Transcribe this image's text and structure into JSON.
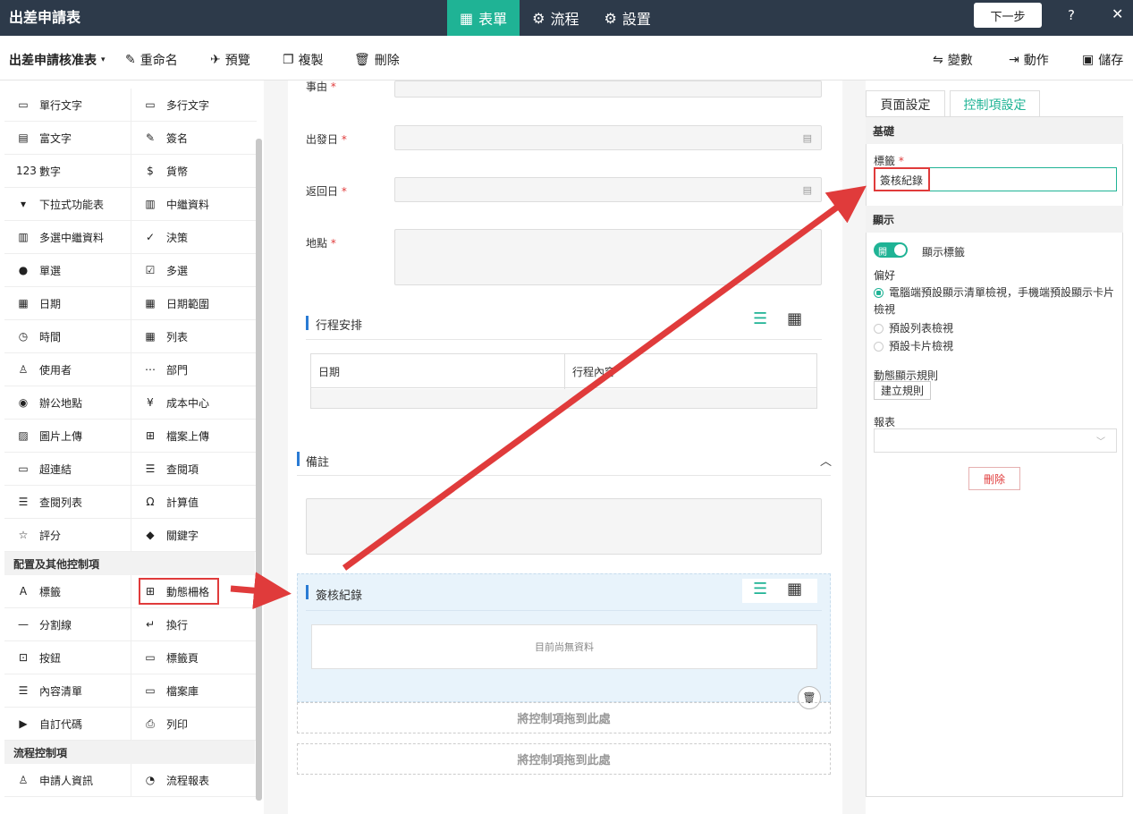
{
  "topbar": {
    "title": "出差申請表",
    "tabs": [
      {
        "label": "表單",
        "icon": "grid-icon"
      },
      {
        "label": "流程",
        "icon": "cogs-icon"
      },
      {
        "label": "設置",
        "icon": "gear-icon"
      }
    ],
    "next_label": "下一步",
    "help_label": "?",
    "close_label": "✕"
  },
  "toolbar": {
    "form_name": "出差申請核准表",
    "rename": "重命名",
    "preview": "預覽",
    "copy": "複製",
    "delete": "刪除",
    "variables": "變數",
    "actions": "動作",
    "save": "儲存"
  },
  "controls": {
    "basic": [
      [
        "單行文字",
        "多行文字"
      ],
      [
        "富文字",
        "簽名"
      ],
      [
        "數字",
        "貨幣"
      ],
      [
        "下拉式功能表",
        "中繼資料"
      ],
      [
        "多選中繼資料",
        "決策"
      ],
      [
        "單選",
        "多選"
      ],
      [
        "日期",
        "日期範圍"
      ],
      [
        "時間",
        "列表"
      ],
      [
        "使用者",
        "部門"
      ],
      [
        "辦公地點",
        "成本中心"
      ],
      [
        "圖片上傳",
        "檔案上傳"
      ],
      [
        "超連結",
        "查閱項"
      ],
      [
        "查閱列表",
        "計算值"
      ],
      [
        "評分",
        "關鍵字"
      ]
    ],
    "layout_header": "配置及其他控制項",
    "layout": [
      [
        "標籤",
        "動態柵格"
      ],
      [
        "分割線",
        "換行"
      ],
      [
        "按鈕",
        "標籤頁"
      ],
      [
        "內容清單",
        "檔案庫"
      ],
      [
        "自訂代碼",
        "列印"
      ]
    ],
    "flow_header": "流程控制項",
    "flow": [
      [
        "申請人資訊",
        "流程報表"
      ]
    ]
  },
  "form": {
    "reason_label": "事由",
    "depart_label": "出發日",
    "return_label": "返回日",
    "location_label": "地點",
    "required_mark": "*",
    "itinerary_title": "行程安排",
    "itinerary_cols": [
      "日期",
      "行程內容"
    ],
    "remarks_title": "備註",
    "approval_title": "簽核紀錄",
    "no_data": "目前尚無資料",
    "drop_hint": "將控制項拖到此處"
  },
  "props": {
    "tab_page": "頁面設定",
    "tab_control": "控制項設定",
    "basic_header": "基礎",
    "label_caption": "標籤",
    "label_value": "簽核紀錄",
    "display_header": "顯示",
    "toggle_label": "開",
    "show_label_text": "顯示標籤",
    "preference_caption": "偏好",
    "pref_options": [
      "電腦端預設顯示清單檢視，手機端預設顯示卡片檢視",
      "預設列表檢視",
      "預設卡片檢視"
    ],
    "dynamic_rule_caption": "動態顯示規則",
    "create_rule": "建立規則",
    "report_caption": "報表",
    "delete_button": "刪除"
  },
  "colors": {
    "topbar": "#2d3a4a",
    "accent": "#1fb395",
    "annotation": "#e03b3b",
    "section_bar": "#2a7bd4"
  }
}
